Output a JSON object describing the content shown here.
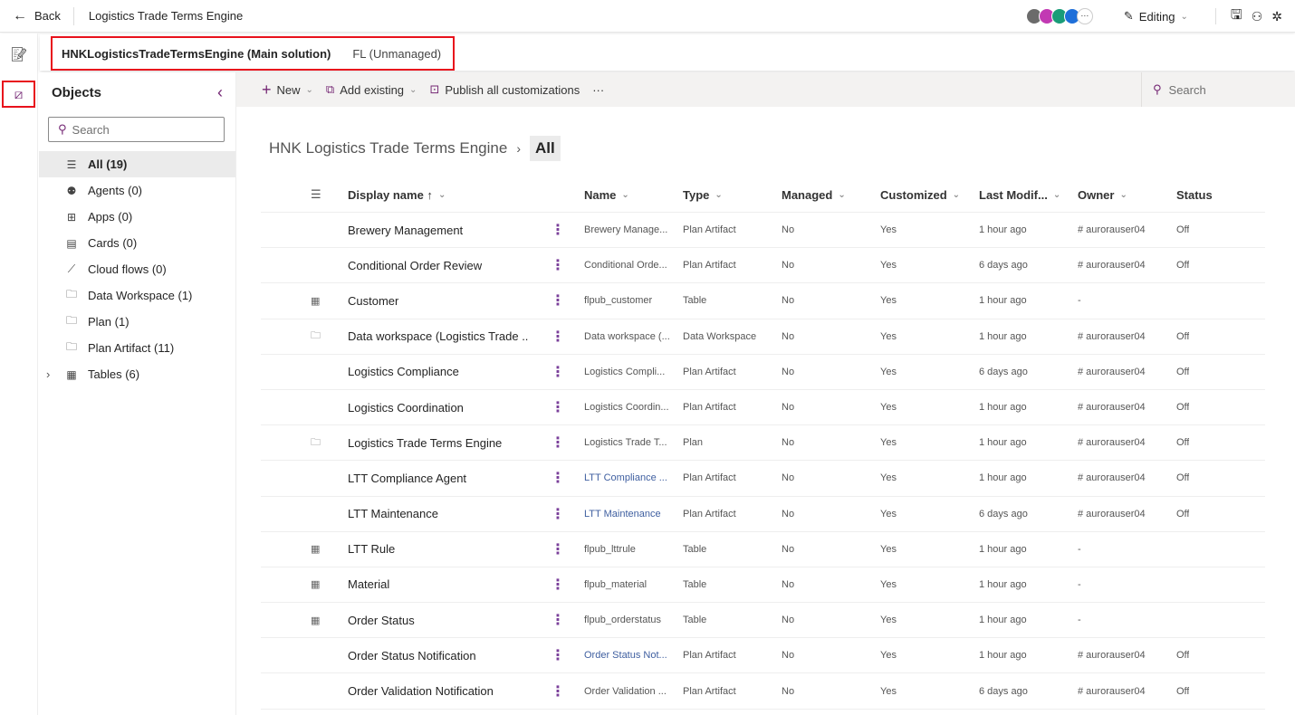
{
  "topbar": {
    "back_label": "Back",
    "app_title": "Logistics Trade Terms Engine",
    "editing_label": "Editing",
    "avatar_colors": [
      "#6b6b6b",
      "#c239b3",
      "#1a9c78",
      "#1e6fd9"
    ]
  },
  "solution": {
    "name": "HNKLogisticsTradeTermsEngine (Main solution)",
    "state": "FL (Unmanaged)"
  },
  "objects": {
    "title": "Objects",
    "search_placeholder": "Search",
    "items": [
      {
        "label": "All",
        "count": "(19)",
        "icon": "list-icon",
        "selected": true
      },
      {
        "label": "Agents",
        "count": "(0)",
        "icon": "bot-icon"
      },
      {
        "label": "Apps",
        "count": "(0)",
        "icon": "apps-icon"
      },
      {
        "label": "Cards",
        "count": "(0)",
        "icon": "card-icon"
      },
      {
        "label": "Cloud flows",
        "count": "(0)",
        "icon": "flow-icon"
      },
      {
        "label": "Data Workspace",
        "count": "(1)",
        "icon": "folder-icon"
      },
      {
        "label": "Plan",
        "count": "(1)",
        "icon": "folder-icon"
      },
      {
        "label": "Plan Artifact",
        "count": "(11)",
        "icon": "folder-icon"
      },
      {
        "label": "Tables",
        "count": "(6)",
        "icon": "table-icon",
        "expandable": true
      }
    ]
  },
  "commands": {
    "new": "New",
    "add_existing": "Add existing",
    "publish": "Publish all customizations",
    "more": "···",
    "search_placeholder": "Search"
  },
  "breadcrumb": {
    "parent": "HNK Logistics Trade Terms Engine",
    "current": "All"
  },
  "table": {
    "columns": [
      "Display name ↑",
      "Name",
      "Type",
      "Managed",
      "Customized",
      "Last Modif...",
      "Owner",
      "Status"
    ],
    "rows": [
      {
        "icon": "",
        "display": "Brewery Management",
        "name": "Brewery Manage...",
        "type": "Plan Artifact",
        "managed": "No",
        "customized": "Yes",
        "modified": "1 hour ago",
        "owner": "# aurorauser04",
        "status": "Off"
      },
      {
        "icon": "",
        "display": "Conditional Order Review",
        "name": "Conditional Orde...",
        "type": "Plan Artifact",
        "managed": "No",
        "customized": "Yes",
        "modified": "6 days ago",
        "owner": "# aurorauser04",
        "status": "Off"
      },
      {
        "icon": "table",
        "display": "Customer",
        "name": "flpub_customer",
        "type": "Table",
        "managed": "No",
        "customized": "Yes",
        "modified": "1 hour ago",
        "owner": "-",
        "status": ""
      },
      {
        "icon": "folder",
        "display": "Data workspace (Logistics Trade ...",
        "name": "Data workspace (...",
        "type": "Data Workspace",
        "managed": "No",
        "customized": "Yes",
        "modified": "1 hour ago",
        "owner": "# aurorauser04",
        "status": "Off"
      },
      {
        "icon": "",
        "display": "Logistics Compliance",
        "name": "Logistics Compli...",
        "type": "Plan Artifact",
        "managed": "No",
        "customized": "Yes",
        "modified": "6 days ago",
        "owner": "# aurorauser04",
        "status": "Off"
      },
      {
        "icon": "",
        "display": "Logistics Coordination",
        "name": "Logistics Coordin...",
        "type": "Plan Artifact",
        "managed": "No",
        "customized": "Yes",
        "modified": "1 hour ago",
        "owner": "# aurorauser04",
        "status": "Off"
      },
      {
        "icon": "folder",
        "display": "Logistics Trade Terms Engine",
        "name": "Logistics Trade T...",
        "type": "Plan",
        "managed": "No",
        "customized": "Yes",
        "modified": "1 hour ago",
        "owner": "# aurorauser04",
        "status": "Off"
      },
      {
        "icon": "",
        "display": "LTT Compliance Agent",
        "name": "LTT Compliance ...",
        "type": "Plan Artifact",
        "managed": "No",
        "customized": "Yes",
        "modified": "1 hour ago",
        "owner": "# aurorauser04",
        "status": "Off"
      },
      {
        "icon": "",
        "display": "LTT Maintenance",
        "name": "LTT Maintenance",
        "type": "Plan Artifact",
        "managed": "No",
        "customized": "Yes",
        "modified": "6 days ago",
        "owner": "# aurorauser04",
        "status": "Off"
      },
      {
        "icon": "table",
        "display": "LTT Rule",
        "name": "flpub_lttrule",
        "type": "Table",
        "managed": "No",
        "customized": "Yes",
        "modified": "1 hour ago",
        "owner": "-",
        "status": ""
      },
      {
        "icon": "table",
        "display": "Material",
        "name": "flpub_material",
        "type": "Table",
        "managed": "No",
        "customized": "Yes",
        "modified": "1 hour ago",
        "owner": "-",
        "status": ""
      },
      {
        "icon": "table",
        "display": "Order Status",
        "name": "flpub_orderstatus",
        "type": "Table",
        "managed": "No",
        "customized": "Yes",
        "modified": "1 hour ago",
        "owner": "-",
        "status": ""
      },
      {
        "icon": "",
        "display": "Order Status Notification",
        "name": "Order Status Not...",
        "type": "Plan Artifact",
        "managed": "No",
        "customized": "Yes",
        "modified": "1 hour ago",
        "owner": "# aurorauser04",
        "status": "Off"
      },
      {
        "icon": "",
        "display": "Order Validation Notification",
        "name": "Order Validation ...",
        "type": "Plan Artifact",
        "managed": "No",
        "customized": "Yes",
        "modified": "6 days ago",
        "owner": "# aurorauser04",
        "status": "Off"
      }
    ]
  },
  "colors": {
    "accent": "#742774",
    "highlight_box": "#e8111c"
  }
}
